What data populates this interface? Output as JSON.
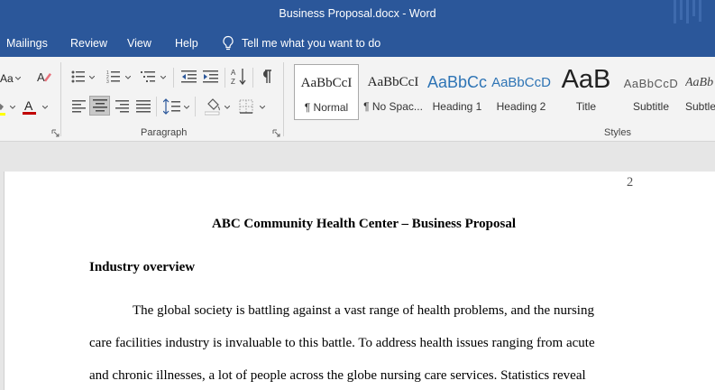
{
  "window": {
    "title": "Business Proposal.docx  -  Word"
  },
  "menu": {
    "tabs": [
      "Mailings",
      "Review",
      "View",
      "Help"
    ],
    "tell_me": "Tell me what you want to do"
  },
  "ribbon": {
    "font_size_label": "Aa",
    "paragraph_group_label": "Paragraph",
    "styles_group_label": "Styles",
    "styles": [
      {
        "sample": "AaBbCcI",
        "name": "¶ Normal"
      },
      {
        "sample": "AaBbCcI",
        "name": "¶ No Spac..."
      },
      {
        "sample": "AaBbCc",
        "name": "Heading 1"
      },
      {
        "sample": "AaBbCcD",
        "name": "Heading 2"
      },
      {
        "sample": "AaB",
        "name": "Title"
      },
      {
        "sample": "AaBbCcD",
        "name": "Subtitle"
      },
      {
        "sample": "AaBb",
        "name": "Subtle"
      }
    ],
    "colors": {
      "highlight": "#ffff00",
      "font_color": "#c00000",
      "accent": "#2b579a"
    }
  },
  "document": {
    "page_number": "2",
    "title": "ABC Community Health Center – Business Proposal",
    "heading": "Industry overview",
    "paragraph_lines": [
      "The global society is battling against a vast range of health problems, and the nursing",
      "care facilities industry is invaluable to this battle. To address health issues ranging from acute",
      "and chronic illnesses, a lot of people across the globe nursing care services. Statistics reveal"
    ]
  }
}
